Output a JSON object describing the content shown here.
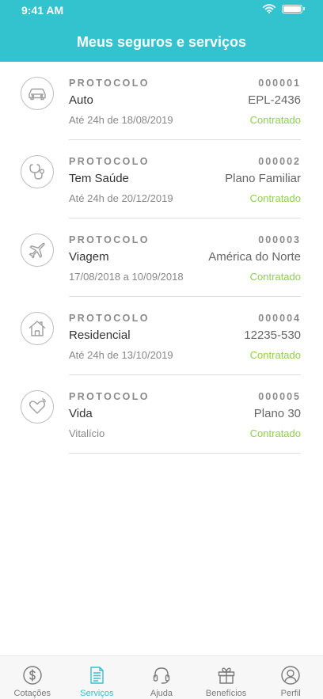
{
  "status_bar": {
    "time": "9:41 AM"
  },
  "header": {
    "title": "Meus seguros e serviços"
  },
  "items": [
    {
      "icon": "car-icon",
      "protocol_label": "PROTOCOLO",
      "protocol_number": "000001",
      "name": "Auto",
      "detail": "EPL-2436",
      "validity": "Até 24h de 18/08/2019",
      "status": "Contratado"
    },
    {
      "icon": "stethoscope-icon",
      "protocol_label": "PROTOCOLO",
      "protocol_number": "000002",
      "name": "Tem Saúde",
      "detail": "Plano Familiar",
      "validity": "Até 24h de 20/12/2019",
      "status": "Contratado"
    },
    {
      "icon": "airplane-icon",
      "protocol_label": "PROTOCOLO",
      "protocol_number": "000003",
      "name": "Viagem",
      "detail": "América do Norte",
      "validity": "17/08/2018 a 10/09/2018",
      "status": "Contratado"
    },
    {
      "icon": "house-icon",
      "protocol_label": "PROTOCOLO",
      "protocol_number": "000004",
      "name": "Residencial",
      "detail": "12235-530",
      "validity": "Até 24h de 13/10/2019",
      "status": "Contratado"
    },
    {
      "icon": "heart-icon",
      "protocol_label": "PROTOCOLO",
      "protocol_number": "000005",
      "name": "Vida",
      "detail": "Plano 30",
      "validity": "Vitalício",
      "status": "Contratado"
    }
  ],
  "tabs": [
    {
      "label": "Cotações",
      "icon": "dollar-coin-icon",
      "active": false
    },
    {
      "label": "Serviços",
      "icon": "document-icon",
      "active": true
    },
    {
      "label": "Ajuda",
      "icon": "headset-icon",
      "active": false
    },
    {
      "label": "Benefícios",
      "icon": "gift-icon",
      "active": false
    },
    {
      "label": "Perfil",
      "icon": "user-icon",
      "active": false
    }
  ],
  "colors": {
    "accent": "#32c3cf",
    "status_ok": "#8ed14a"
  }
}
